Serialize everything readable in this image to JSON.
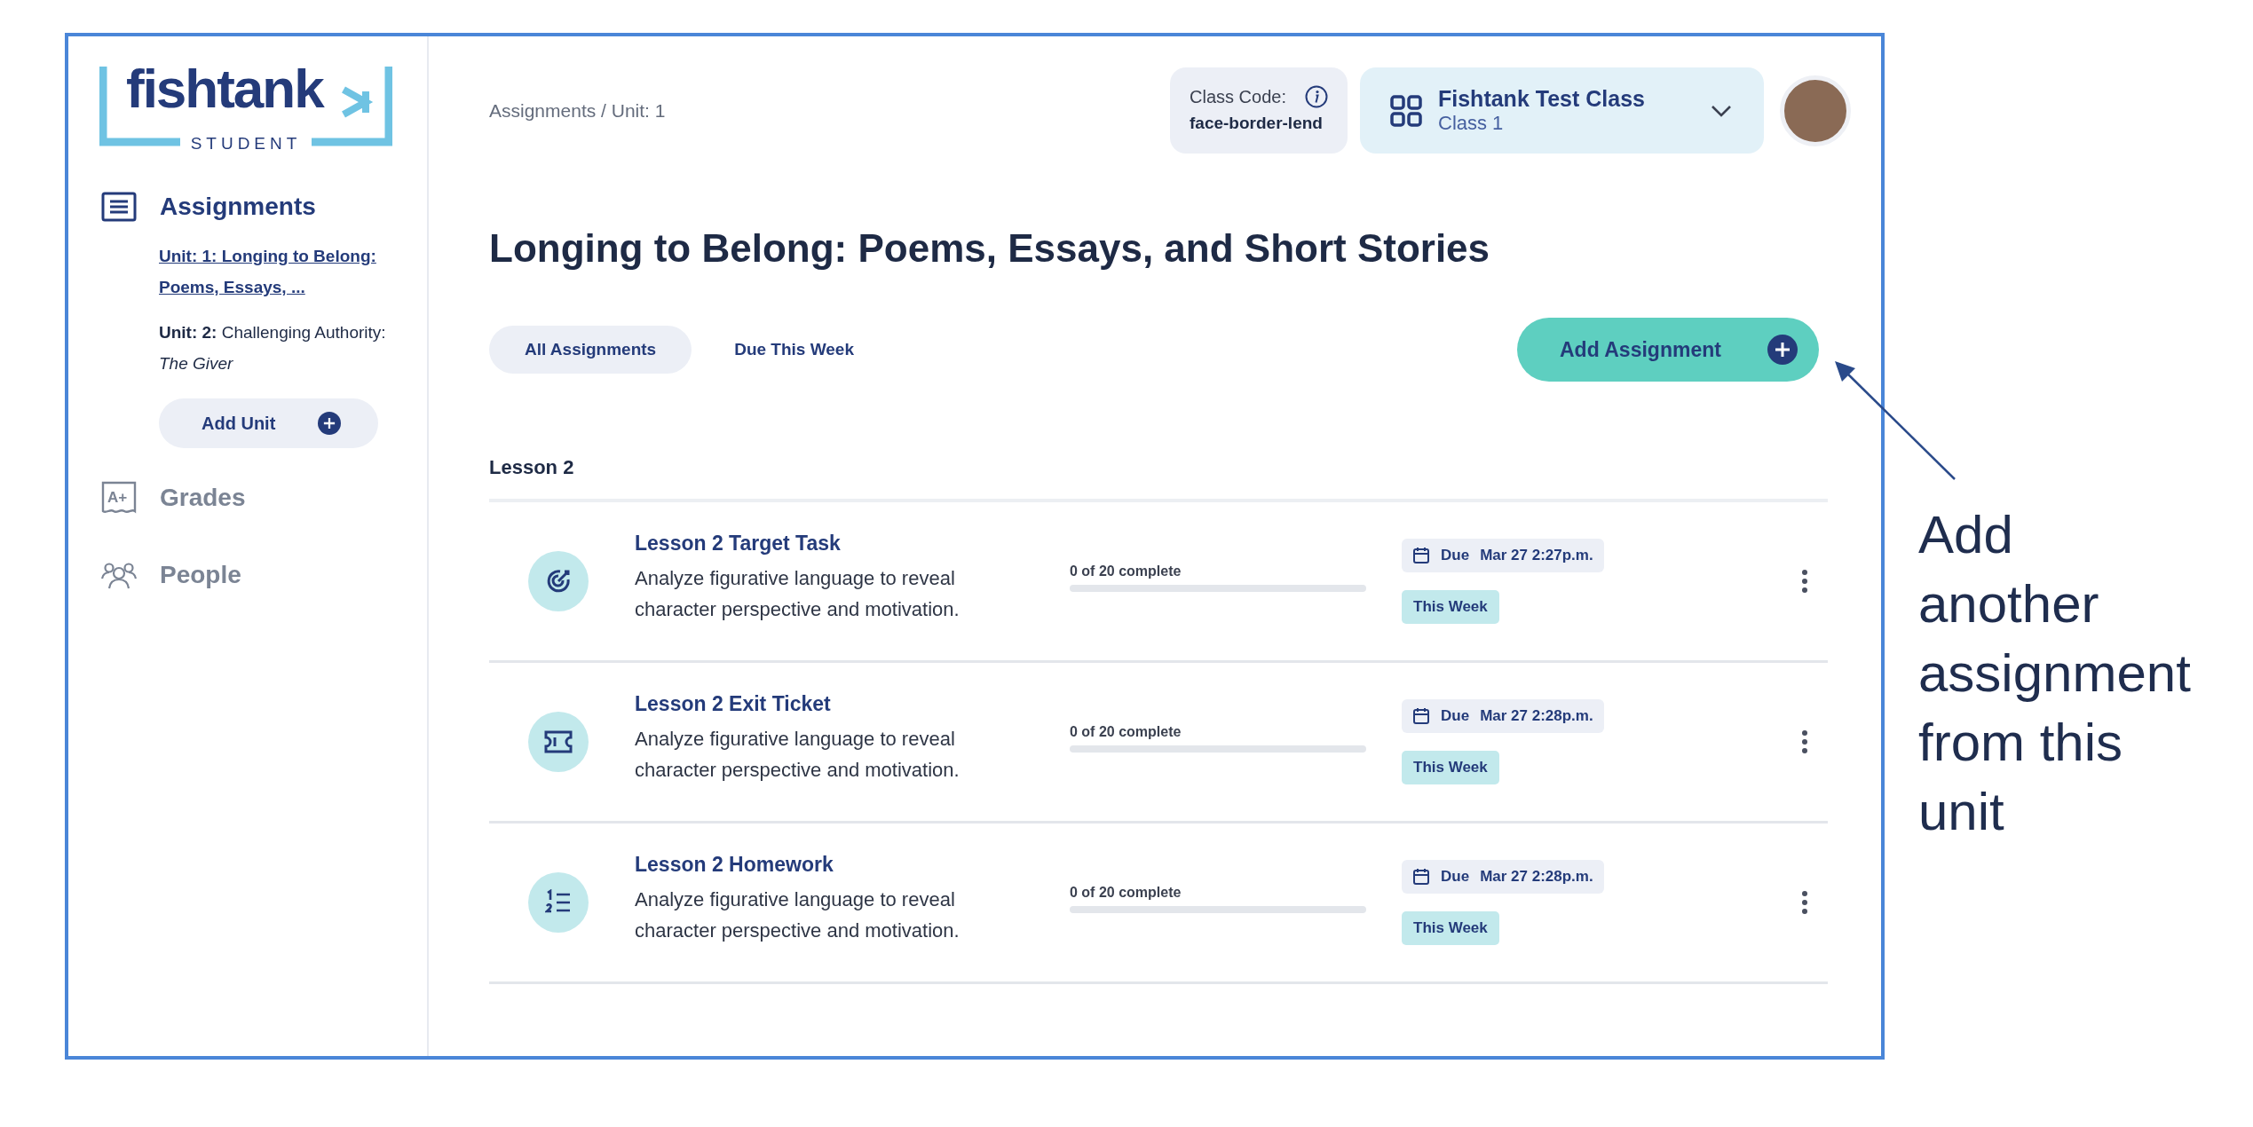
{
  "logo": {
    "wordmark": "fishtank",
    "subtitle": "STUDENT"
  },
  "sidebar": {
    "items": [
      {
        "kind": "assignments",
        "label": "Assignments",
        "selected": true,
        "units": [
          {
            "text": "Unit: 1: Longing to Belong: Poems, Essays, ...",
            "selected": true
          },
          {
            "text": "**Unit: 2:** Challenging Authority: *The Giver*",
            "selected": false
          }
        ],
        "add_button": "Add Unit"
      },
      {
        "kind": "grades",
        "label": "Grades",
        "selected": false,
        "icon_text": "A+"
      },
      {
        "kind": "people",
        "label": "People",
        "selected": false
      }
    ]
  },
  "breadcrumb": "Assignments / Unit: 1",
  "class_code": {
    "label": "Class Code:",
    "value": "face-border-lend"
  },
  "class_selector": {
    "name": "Fishtank Test Class",
    "section": "Class 1"
  },
  "title": "Longing to Belong: Poems, Essays, and Short Stories",
  "filters": [
    {
      "label": "All Assignments",
      "selected": true
    },
    {
      "label": "Due This Week",
      "selected": false
    }
  ],
  "add_assignment_button": "Add Assignment",
  "lesson_heading": "Lesson 2",
  "assignments": [
    {
      "kind": "target-task",
      "title": "Lesson 2 Target Task",
      "description": "Analyze figurative language to reveal character perspective and motivation.",
      "progress": "0 of 20 complete",
      "level": 0,
      "due_label": "Due",
      "due": "Mar 27 2:27p.m.",
      "tag": "This Week"
    },
    {
      "kind": "exit-ticket",
      "title": "Lesson 2 Exit Ticket",
      "description": "Analyze figurative language to reveal character perspective and motivation.",
      "progress": "0 of 20 complete",
      "level": 0,
      "due_label": "Due",
      "due": "Mar 27 2:28p.m.",
      "tag": "This Week"
    },
    {
      "kind": "homework",
      "title": "Lesson 2 Homework",
      "description": "Analyze figurative language to reveal character perspective and motivation.",
      "progress": "0 of 20 complete",
      "level": 0,
      "due_label": "Due",
      "due": "Mar 27 2:28p.m.",
      "tag": "This Week"
    }
  ],
  "annotation": "Add another assignment from this unit"
}
